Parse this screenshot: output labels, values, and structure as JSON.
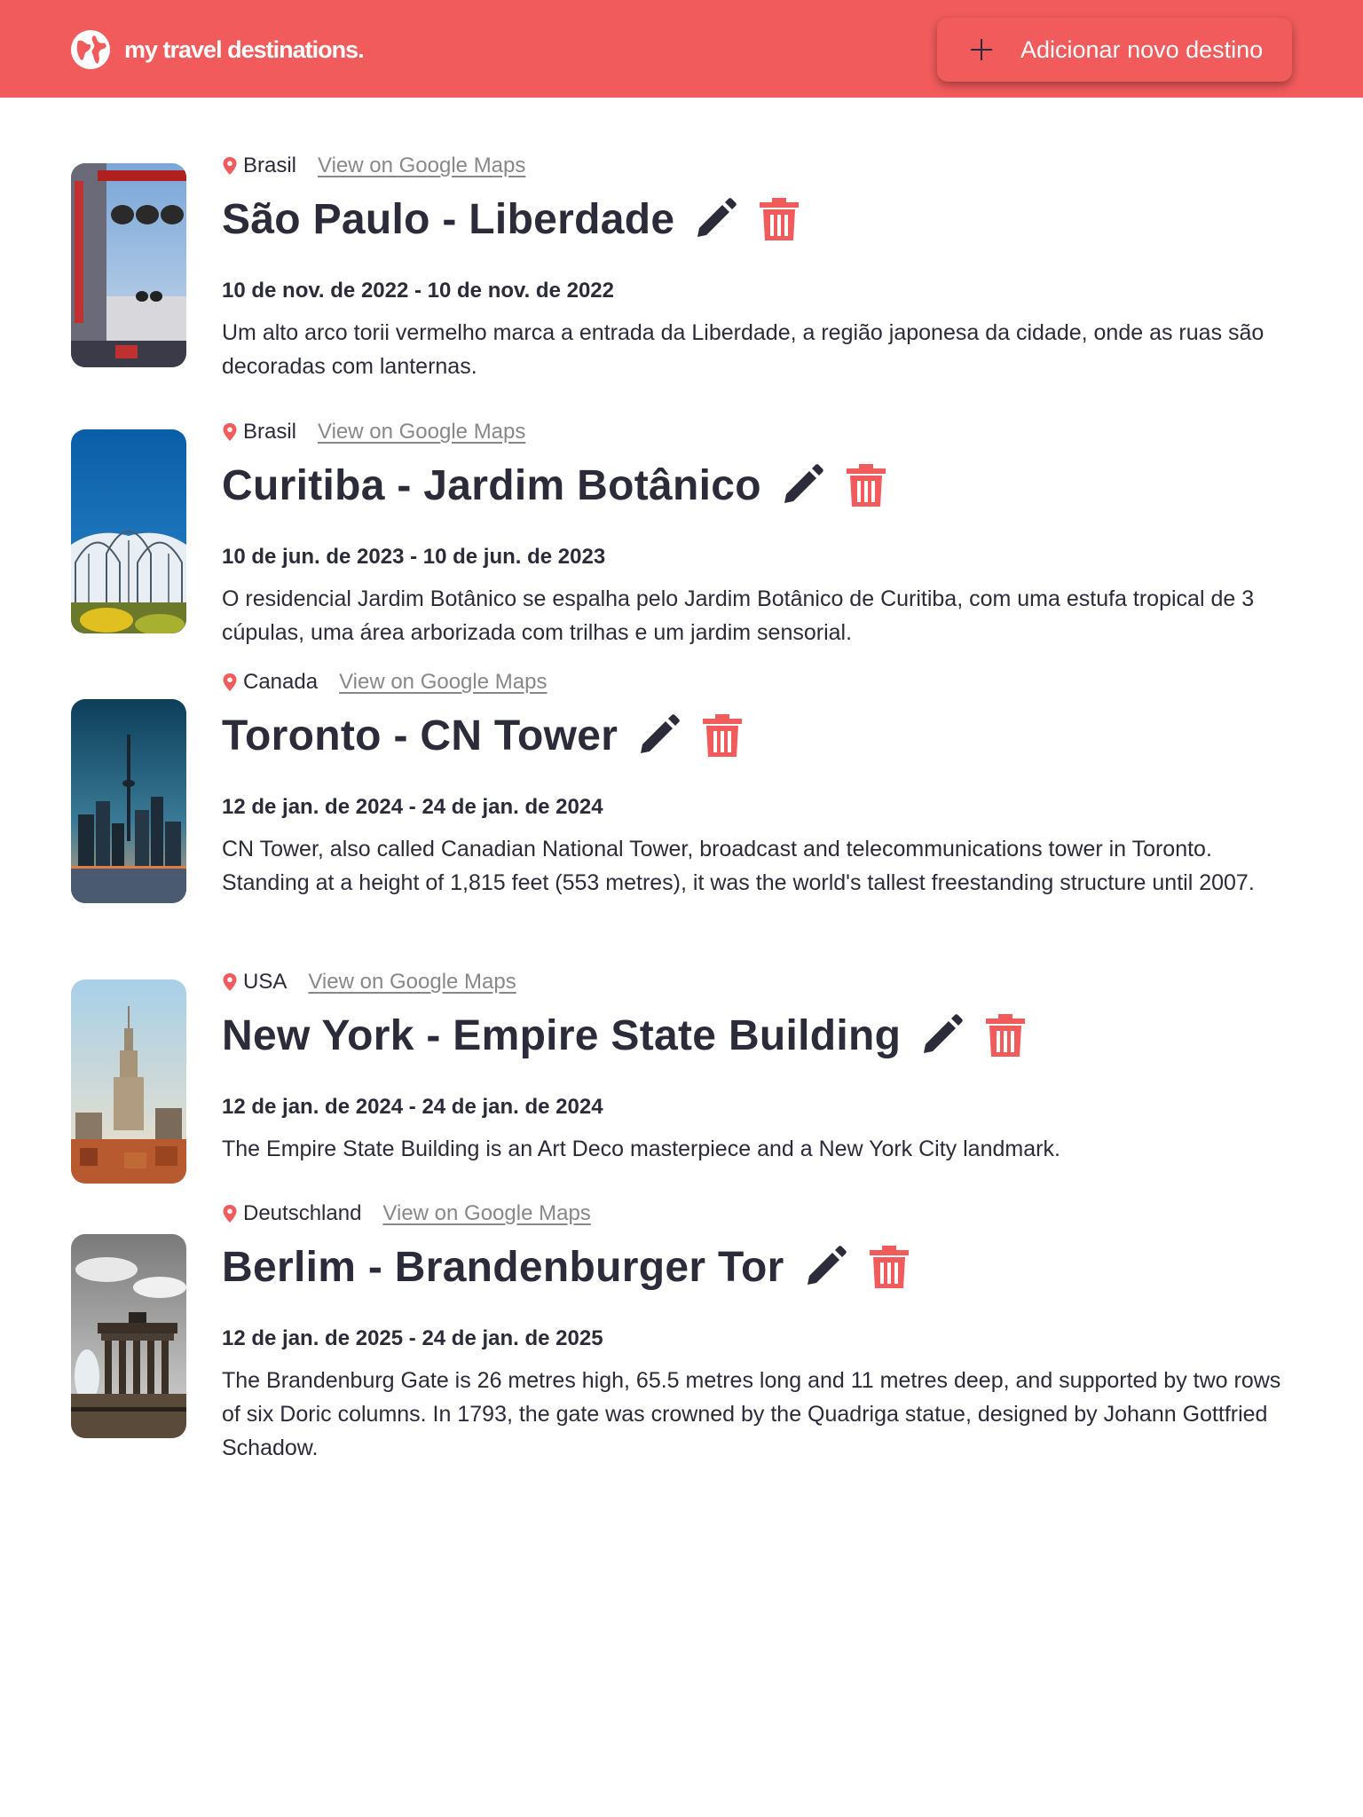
{
  "header": {
    "brand_name": "my travel destinations.",
    "add_button_label": "Adicionar novo destino",
    "brand_color": "#f15b5b",
    "icons": {
      "brand": "globe-icon",
      "add": "plus-icon"
    }
  },
  "destinations": [
    {
      "country": "Brasil",
      "maps_link": "View on Google Maps",
      "title": "São Paulo - Liberdade",
      "dates": "10 de nov. de 2022 - 10 de nov. de 2022",
      "description": "Um alto arco torii vermelho marca a entrada da Liberdade, a região japonesa da cidade, onde as ruas são decoradas com lanternas."
    },
    {
      "country": "Brasil",
      "maps_link": "View on Google Maps",
      "title": "Curitiba - Jardim Botânico",
      "dates": "10 de jun. de 2023 - 10 de jun. de 2023",
      "description": "O residencial Jardim Botânico se espalha pelo Jardim Botânico de Curitiba, com uma estufa tropical de 3 cúpulas, uma área arborizada com trilhas e um jardim sensorial."
    },
    {
      "country": "Canada",
      "maps_link": "View on Google Maps",
      "title": "Toronto - CN Tower",
      "dates": "12 de jan. de 2024 - 24 de jan. de 2024",
      "description": "CN Tower, also called Canadian National Tower, broadcast and telecommunications tower in Toronto. Standing at a height of 1,815 feet (553 metres), it was the world's tallest freestanding structure until 2007."
    },
    {
      "country": "USA",
      "maps_link": "View on Google Maps",
      "title": "New York - Empire State Building",
      "dates": "12 de jan. de 2024 - 24 de jan. de 2024",
      "description": "The Empire State Building is an Art Deco masterpiece and a New York City landmark."
    },
    {
      "country": "Deutschland",
      "maps_link": "View on Google Maps",
      "title": "Berlim - Brandenburger Tor",
      "dates": "12 de jan. de 2025 - 24 de jan. de 2025",
      "description": "The Brandenburg Gate is 26 metres high, 65.5 metres long and 11 metres deep, and supported by two rows of six Doric columns. In 1793, the gate was crowned by the Quadriga statue, designed by Johann Gottfried Schadow."
    }
  ],
  "icons": {
    "location": "pin-icon",
    "edit": "pencil-icon",
    "delete": "trash-icon"
  },
  "colors": {
    "accent": "#f15b5b",
    "text": "#2b2b3a",
    "link": "#888888"
  }
}
